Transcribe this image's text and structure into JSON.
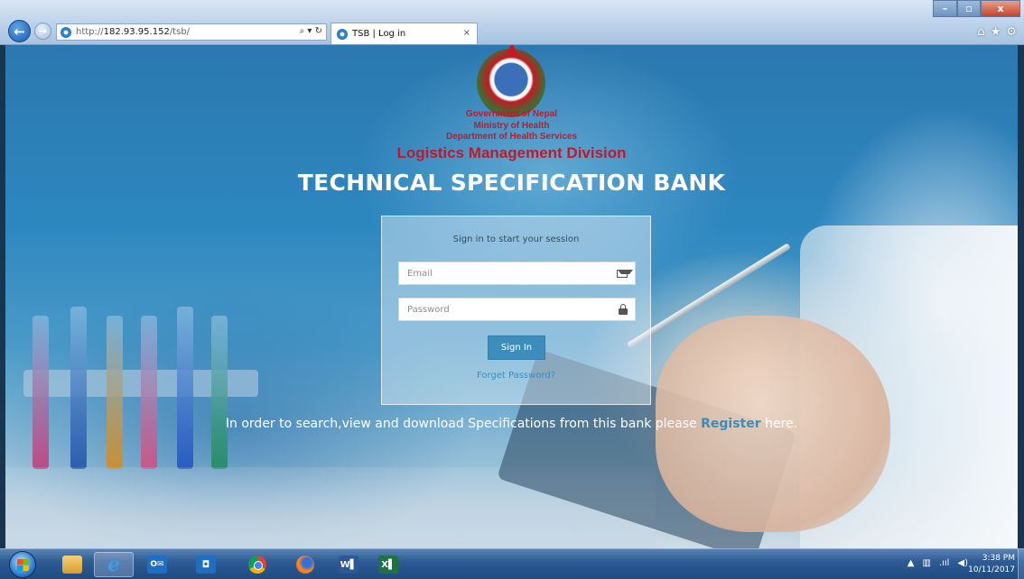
{
  "browser": {
    "address": {
      "prefix": "http://",
      "host": "182.93.95.152",
      "path": "/tsb/"
    },
    "address_tools": "⌕ ▾ ↻",
    "tab_title": "TSB | Log in",
    "tab_close": "×",
    "window_controls": {
      "minimize": "–",
      "maximize": "▫",
      "close": "x"
    },
    "toolbar_icons": [
      "home-icon",
      "favorites-star-icon",
      "gear-icon"
    ]
  },
  "header": {
    "gov_line1": "Government of Nepal",
    "gov_line2": "Ministry of Health",
    "gov_line3": "Department of Health Services",
    "division": "Logistics Management Division",
    "title": "TECHNICAL SPECIFICATION BANK"
  },
  "login": {
    "message": "Sign in to start your session",
    "email_placeholder": "Email",
    "password_placeholder": "Password",
    "signin_label": "Sign In",
    "forget_label": "Forget Password?"
  },
  "register_note": {
    "before": "In order to search,view and download Specifications from this bank please ",
    "link": "Register",
    "after": " here."
  },
  "taskbar": {
    "items": [
      "start-button",
      "file-explorer-icon",
      "internet-explorer-icon",
      "outlook-icon",
      "app-icon",
      "chrome-icon",
      "firefox-icon",
      "word-icon",
      "excel-icon"
    ],
    "outlook_glyph": "O✉",
    "blue_app_glyph": "◘",
    "word_glyph": "W▌",
    "excel_glyph": "X▌",
    "ie_glyph": "e",
    "tray": {
      "arrow": "▲",
      "network": "▥",
      "signal": ".ııl",
      "volume": "◀)"
    },
    "time": "3:38 PM",
    "date": "10/11/2017"
  },
  "colors": {
    "primary_button": "#3c8dbc",
    "header_red": "#c0192a",
    "title_white": "#ffffff"
  }
}
